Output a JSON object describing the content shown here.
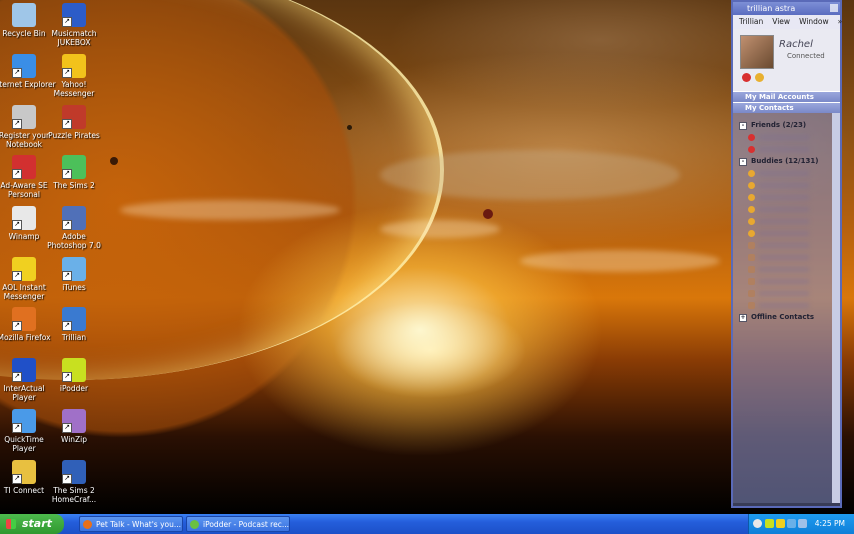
{
  "desktop": {
    "icons": [
      {
        "label": "Recycle Bin",
        "color": "#9fc6e8"
      },
      {
        "label": "Musicmatch JUKEBOX",
        "color": "#2c5cc8"
      },
      {
        "label": "Internet Explorer",
        "color": "#3a8ee6"
      },
      {
        "label": "Yahoo! Messenger",
        "color": "#f2c21b"
      },
      {
        "label": "Register your Notebook",
        "color": "#c8c8c8"
      },
      {
        "label": "Puzzle Pirates",
        "color": "#c03a2a"
      },
      {
        "label": "Ad-Aware SE Personal",
        "color": "#d23030"
      },
      {
        "label": "The Sims 2",
        "color": "#4cc05a"
      },
      {
        "label": "Winamp",
        "color": "#e8e8e8"
      },
      {
        "label": "Adobe Photoshop 7.0",
        "color": "#5070b8"
      },
      {
        "label": "AOL Instant Messenger",
        "color": "#f0d020"
      },
      {
        "label": "iTunes",
        "color": "#6ab0e8"
      },
      {
        "label": "Mozilla Firefox",
        "color": "#e07020"
      },
      {
        "label": "Trillian",
        "color": "#3a7ad0"
      },
      {
        "label": "InterActual Player",
        "color": "#2050c8"
      },
      {
        "label": "iPodder",
        "color": "#c8e020"
      },
      {
        "label": "QuickTime Player",
        "color": "#4a9ae8"
      },
      {
        "label": "WinZip",
        "color": "#a070c8"
      },
      {
        "label": "TI Connect",
        "color": "#e8c040"
      },
      {
        "label": "The Sims 2 HomeCraf...",
        "color": "#3060b8"
      }
    ]
  },
  "trillian": {
    "title": "trillian astra",
    "menu": [
      "Trillian",
      "View",
      "Window",
      "»"
    ],
    "user_name": "Rachel",
    "user_status": "Connected",
    "sections": [
      "My Mail Accounts",
      "My Contacts"
    ],
    "groups": {
      "friends": "Friends (2/23)",
      "buddies": "Buddies (12/131)",
      "offline": "Offline Contacts"
    },
    "colors": {
      "away": "#e8a830",
      "offline_red": "#d83030",
      "bar": "#7a88c8"
    }
  },
  "taskbar": {
    "start_label": "start",
    "tasks": [
      {
        "label": "Pet Talk - What's you...",
        "color": "#e8701a"
      },
      {
        "label": "iPodder - Podcast rec...",
        "color": "#6ac040"
      }
    ],
    "clock": "4:25 PM"
  }
}
